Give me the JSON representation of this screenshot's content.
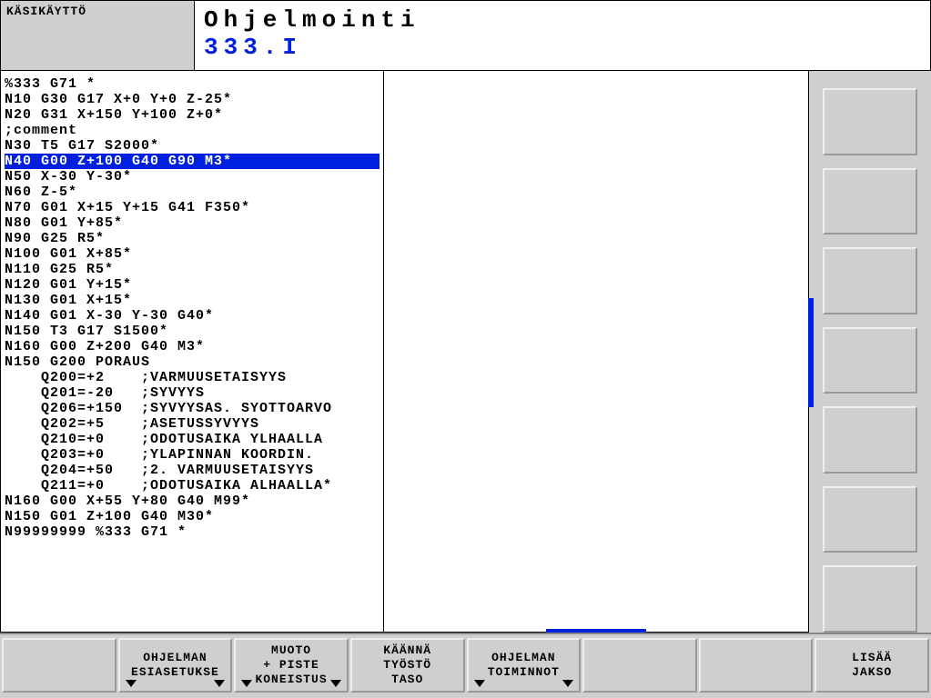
{
  "header": {
    "mode": "KÄSIKÄYTTÖ",
    "title_line1": "Ohjelmointi",
    "title_line2": "333.I"
  },
  "program": {
    "selected_index": 5,
    "lines": [
      "%333 G71 *",
      "N10 G30 G17 X+0 Y+0 Z-25*",
      "N20 G31 X+150 Y+100 Z+0*",
      ";comment",
      "N30 T5 G17 S2000*",
      "N40 G00 Z+100 G40 G90 M3*",
      "N50 X-30 Y-30*",
      "N60 Z-5*",
      "N70 G01 X+15 Y+15 G41 F350*",
      "N80 G01 Y+85*",
      "N90 G25 R5*",
      "N100 G01 X+85*",
      "N110 G25 R5*",
      "N120 G01 Y+15*",
      "N130 G01 X+15*",
      "N140 G01 X-30 Y-30 G40*",
      "N150 T3 G17 S1500*",
      "N160 G00 Z+200 G40 M3*",
      "N150 G200 PORAUS",
      "    Q200=+2    ;VARMUUSETAISYYS",
      "    Q201=-20   ;SYVYYS",
      "    Q206=+150  ;SYVYYSAS. SYOTTOARVO",
      "    Q202=+5    ;ASETUSSYVYYS",
      "    Q210=+0    ;ODOTUSAIKA YLHAALLA",
      "    Q203=+0    ;YLAPINNAN KOORDIN.",
      "    Q204=+50   ;2. VARMUUSETAISYYS",
      "    Q211=+0    ;ODOTUSAIKA ALHAALLA*",
      "N160 G00 X+55 Y+80 G40 M99*",
      "N150 G01 Z+100 G40 M30*",
      "N99999999 %333 G71 *"
    ]
  },
  "softkeys": [
    {
      "label": "",
      "arrows": false
    },
    {
      "label": "OHJELMAN\nESIASETUKSE",
      "arrows": true
    },
    {
      "label": "MUOTO\n+ PISTE\nKONEISTUS",
      "arrows": true
    },
    {
      "label": "KÄÄNNÄ\nTYÖSTÖ\nTASO",
      "arrows": false
    },
    {
      "label": "OHJELMAN\nTOIMINNOT",
      "arrows": true
    },
    {
      "label": "",
      "arrows": false
    },
    {
      "label": "",
      "arrows": false
    },
    {
      "label": "LISÄÄ\nJAKSO",
      "arrows": false
    }
  ],
  "side_button_count": 7,
  "colors": {
    "accent": "#0020e0",
    "panel_bg": "#cfcfcf"
  }
}
